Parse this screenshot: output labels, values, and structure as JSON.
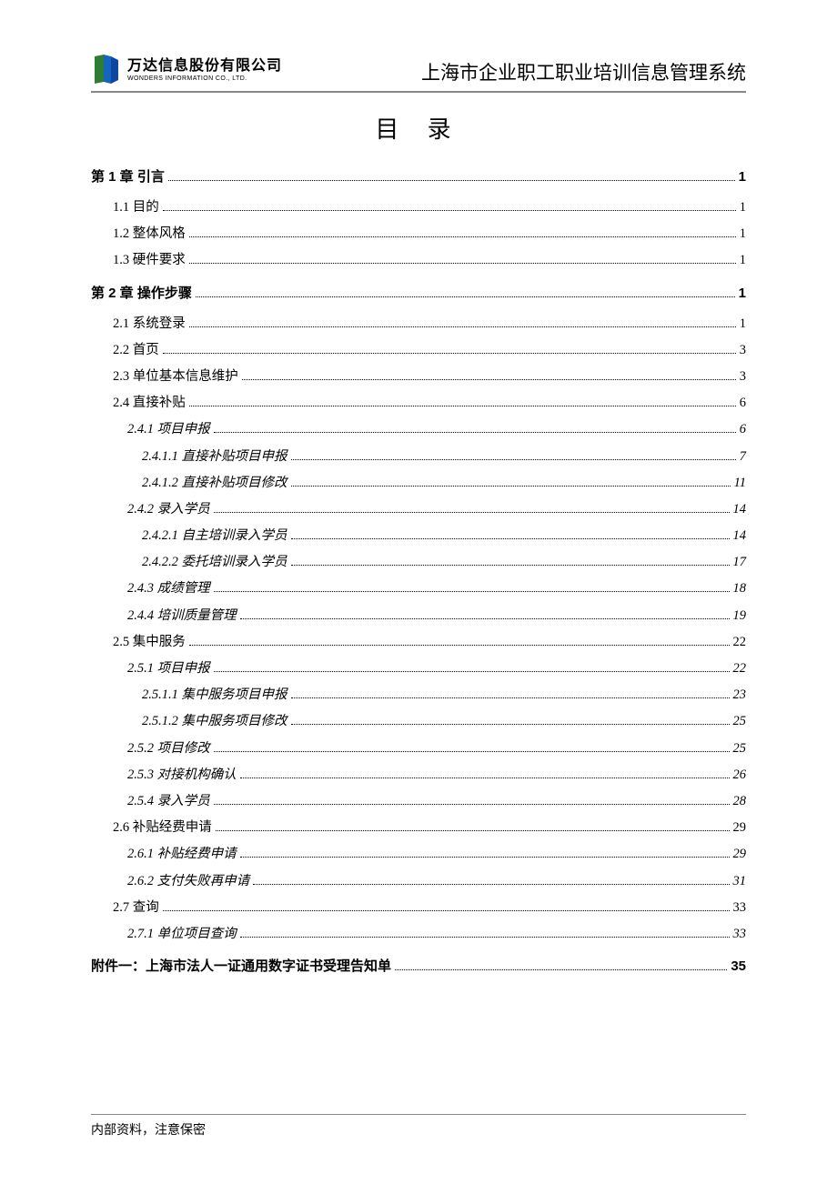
{
  "header": {
    "logo_cn": "万达信息股份有限公司",
    "logo_en": "WONDERS INFORMATION CO., LTD.",
    "doc_title": "上海市企业职工职业培训信息管理系统"
  },
  "toc_title": "目 录",
  "toc": [
    {
      "level": 0,
      "label": "第 1 章  引言",
      "page": "1"
    },
    {
      "level": 1,
      "label": "1.1 目的",
      "page": "1"
    },
    {
      "level": 1,
      "label": "1.2 整体风格",
      "page": "1"
    },
    {
      "level": 1,
      "label": "1.3 硬件要求",
      "page": "1"
    },
    {
      "level": 0,
      "label": "第 2 章  操作步骤",
      "page": "1"
    },
    {
      "level": 1,
      "label": "2.1 系统登录",
      "page": "1"
    },
    {
      "level": 1,
      "label": "2.2 首页",
      "page": "3"
    },
    {
      "level": 1,
      "label": "2.3 单位基本信息维护",
      "page": "3"
    },
    {
      "level": 1,
      "label": "2.4 直接补贴",
      "page": "6"
    },
    {
      "level": 2,
      "label": "2.4.1 项目申报",
      "page": "6"
    },
    {
      "level": 3,
      "label": "2.4.1.1 直接补贴项目申报",
      "page": "7"
    },
    {
      "level": 3,
      "label": "2.4.1.2 直接补贴项目修改",
      "page": "11"
    },
    {
      "level": 2,
      "label": "2.4.2 录入学员",
      "page": "14"
    },
    {
      "level": 3,
      "label": "2.4.2.1 自主培训录入学员",
      "page": "14"
    },
    {
      "level": 3,
      "label": "2.4.2.2 委托培训录入学员",
      "page": "17"
    },
    {
      "level": 2,
      "label": "2.4.3 成绩管理",
      "page": "18"
    },
    {
      "level": 2,
      "label": "2.4.4 培训质量管理",
      "page": "19"
    },
    {
      "level": 1,
      "label": "2.5 集中服务",
      "page": "22"
    },
    {
      "level": 2,
      "label": "2.5.1 项目申报",
      "page": "22"
    },
    {
      "level": 3,
      "label": "2.5.1.1 集中服务项目申报",
      "page": "23"
    },
    {
      "level": 3,
      "label": "2.5.1.2 集中服务项目修改",
      "page": "25"
    },
    {
      "level": 2,
      "label": "2.5.2 项目修改",
      "page": "25"
    },
    {
      "level": 2,
      "label": "2.5.3 对接机构确认",
      "page": "26"
    },
    {
      "level": 2,
      "label": "2.5.4 录入学员",
      "page": "28"
    },
    {
      "level": 1,
      "label": "2.6 补贴经费申请",
      "page": "29"
    },
    {
      "level": 2,
      "label": "2.6.1 补贴经费申请",
      "page": "29"
    },
    {
      "level": 2,
      "label": "2.6.2 支付失败再申请",
      "page": "31"
    },
    {
      "level": 1,
      "label": "2.7 查询",
      "page": "33"
    },
    {
      "level": 2,
      "label": "2.7.1 单位项目查询",
      "page": "33"
    },
    {
      "level": 0,
      "label": "附件一：上海市法人一证通用数字证书受理告知单 ",
      "page": "35"
    }
  ],
  "footer": "内部资料，注意保密"
}
